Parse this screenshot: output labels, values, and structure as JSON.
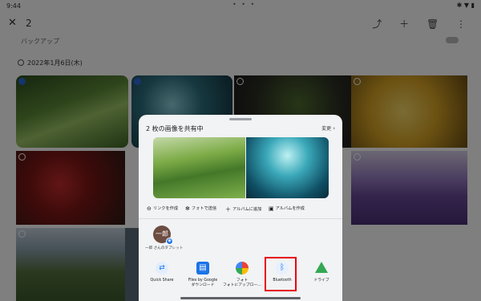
{
  "status": {
    "time": "9:44",
    "dots": "• • •",
    "icons": "✱ ▼ ▮"
  },
  "topbar": {
    "close_icon": "close-icon",
    "selection_count": "2",
    "actions": "⤴ ＋ 🗑 ⋮"
  },
  "backup_label": "バックアップ",
  "date_section": "2022年1月6日(木)",
  "share_sheet": {
    "title": "2 枚の画像を共有中",
    "edit_label": "変更",
    "edit_chevron": "›",
    "actions": [
      {
        "icon": "link-icon",
        "glyph": "⊖",
        "label": "リンクを作成"
      },
      {
        "icon": "photos-send-icon",
        "glyph": "✻",
        "label": "フォトで送信"
      },
      {
        "icon": "add-icon",
        "glyph": "＋",
        "label": "アルバムに追加"
      },
      {
        "icon": "album-icon",
        "glyph": "▣",
        "label": "アルバムを作成"
      }
    ],
    "contact": {
      "avatar_text": "一郎",
      "badge_glyph": "◉",
      "label": "一郎 さんのタブレット"
    },
    "apps": [
      {
        "icon": "quick-share-icon",
        "glyph": "⇄",
        "label": "Quick Share",
        "label2": ""
      },
      {
        "icon": "files-icon",
        "glyph": "▤",
        "label": "Files by Google",
        "label2": "ダウンロード"
      },
      {
        "icon": "photos-icon",
        "glyph": "",
        "label": "フォト",
        "label2": "フォトにアップロー…"
      },
      {
        "icon": "bluetooth-icon",
        "glyph": "ᛒ",
        "label": "Bluetooth",
        "label2": ""
      },
      {
        "icon": "drive-icon",
        "glyph": "",
        "label": "ドライブ",
        "label2": ""
      }
    ]
  },
  "colors": {
    "accent": "#1a73e8",
    "highlight": "#e60012",
    "sheet_bg": "#f1f3f5"
  }
}
